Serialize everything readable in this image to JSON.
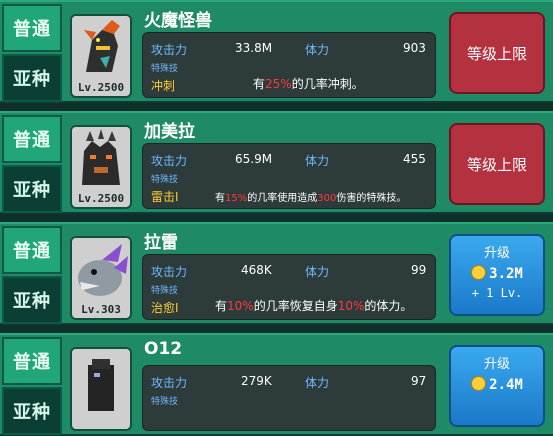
{
  "tabs": {
    "normal": "普通",
    "sub": "亚种"
  },
  "labels": {
    "attack": "攻击力",
    "hp": "体力",
    "skill": "特殊技"
  },
  "cards": [
    {
      "name": "火魔怪兽",
      "level": "Lv.2500",
      "attack": "33.8M",
      "hp": "903",
      "skill": "冲刺",
      "desc_pre": "有",
      "desc_hl": "25%",
      "desc_post": "的几率冲刺。",
      "button": {
        "type": "max",
        "label": "等级上限"
      }
    },
    {
      "name": "加美拉",
      "level": "Lv.2500",
      "attack": "65.9M",
      "hp": "455",
      "skill": "雷击I",
      "desc_pre": "有",
      "desc_hl": "15%",
      "desc_mid": "的几率使用造成",
      "desc_hl2": "300",
      "desc_post": "伤害的特殊技。",
      "button": {
        "type": "max",
        "label": "等级上限"
      }
    },
    {
      "name": "拉雷",
      "level": "Lv.303",
      "attack": "468K",
      "hp": "99",
      "skill": "治愈I",
      "desc_pre": "有",
      "desc_hl": "10%",
      "desc_mid": "的几率恢复自身",
      "desc_hl2": "10%",
      "desc_post": "的体力。",
      "button": {
        "type": "upgrade",
        "label": "升级",
        "cost": "3.2M",
        "plus": "+ 1 Lv."
      }
    },
    {
      "name": "O12",
      "level": "",
      "attack": "279K",
      "hp": "97",
      "skill": "",
      "desc_pre": "",
      "desc_hl": "",
      "desc_post": "",
      "button": {
        "type": "upgrade",
        "label": "升级",
        "cost": "2.4M",
        "plus": ""
      }
    }
  ],
  "colors": {
    "row_bg": "#1f8a66",
    "panel_bg": "#2e3b3b",
    "highlight": "#ff3a3a",
    "skill": "#ffcc33",
    "label": "#6fb8ff"
  }
}
